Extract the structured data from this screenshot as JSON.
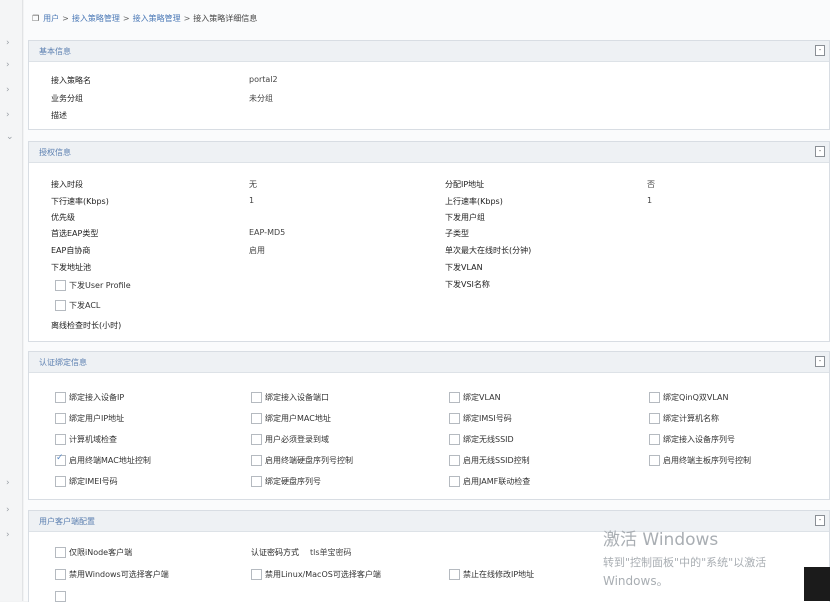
{
  "breadcrumb": {
    "items": [
      "用户",
      "接入策略管理",
      "接入策略管理",
      "接入策略详细信息"
    ]
  },
  "left_rail": {
    "arrow_glyph": "›"
  },
  "basic": {
    "title": "基本信息",
    "fields": [
      {
        "label": "接入策略名",
        "value": "portal2"
      },
      {
        "label": "业务分组",
        "value": "未分组"
      },
      {
        "label": "描述",
        "value": ""
      }
    ]
  },
  "auth": {
    "title": "授权信息",
    "left": [
      {
        "label": "接入时段",
        "value": "无"
      },
      {
        "label": "下行速率(Kbps)",
        "value": "1"
      },
      {
        "label": "优先级",
        "value": ""
      },
      {
        "label": "首选EAP类型",
        "value": "EAP-MD5"
      },
      {
        "label": "EAP自协商",
        "value": "启用"
      },
      {
        "label": "下发地址池",
        "value": ""
      }
    ],
    "right": [
      {
        "label": "分配IP地址",
        "value": "否"
      },
      {
        "label": "上行速率(Kbps)",
        "value": "1"
      },
      {
        "label": "下发用户组",
        "value": ""
      },
      {
        "label": "子类型",
        "value": ""
      },
      {
        "label": "单次最大在线时长(分钟)",
        "value": ""
      },
      {
        "label": "下发VLAN",
        "value": ""
      },
      {
        "label": "下发VSI名称",
        "value": ""
      }
    ],
    "user_profile": "下发User Profile",
    "acl": "下发ACL",
    "offline_check": "离线检查时长(小时)"
  },
  "binding": {
    "title": "认证绑定信息",
    "items": [
      [
        "绑定接入设备IP",
        "绑定接入设备端口",
        "绑定VLAN",
        "绑定QinQ双VLAN"
      ],
      [
        "绑定用户IP地址",
        "绑定用户MAC地址",
        "绑定IMSI号码",
        "绑定计算机名称"
      ],
      [
        "计算机域检查",
        "用户必须登录到域",
        "绑定无线SSID",
        "绑定接入设备序列号"
      ],
      [
        "启用终端MAC地址控制",
        "启用终端硬盘序列号控制",
        "启用无线SSID控制",
        "启用终端主板序列号控制"
      ],
      [
        "绑定IMEI号码",
        "绑定硬盘序列号",
        "启用JAMF联动检查",
        ""
      ]
    ],
    "checked": [
      "启用终端MAC地址控制"
    ]
  },
  "client": {
    "title": "用户客户端配置",
    "items": [
      "仅限iNode客户端",
      "禁用Windows可选择客户端",
      "禁用Linux/MacOS可选择客户端",
      "禁止在线修改IP地址"
    ],
    "auth_method_label": "认证密码方式",
    "auth_method_value": "tls单宝密码"
  },
  "watermark": {
    "line1": "激活 Windows",
    "line2": "转到\"控制面板\"中的\"系统\"以激活",
    "line3": "Windows。"
  }
}
